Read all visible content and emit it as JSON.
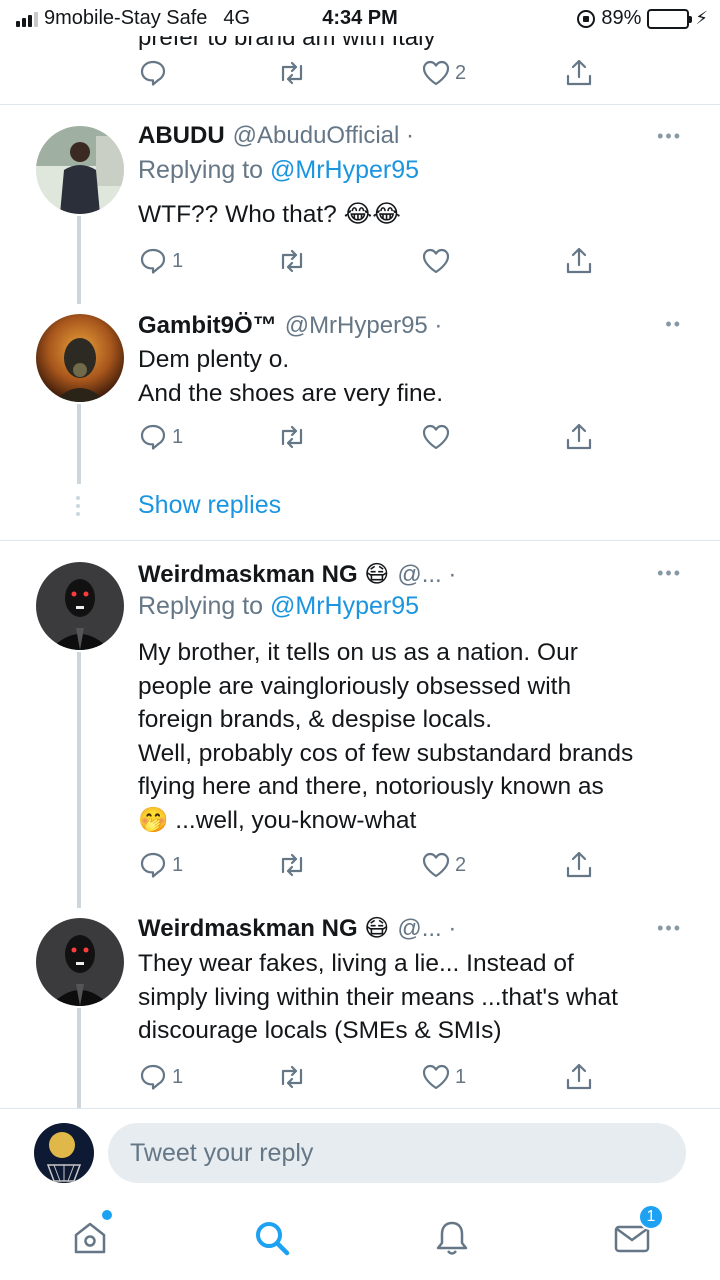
{
  "status_bar": {
    "carrier": "9mobile-Stay Safe",
    "network": "4G",
    "time": "4:34 PM",
    "battery": "89%",
    "battery_level": 0.89
  },
  "top_cut_text": "prefer to brand am with Italy",
  "top_actions": {
    "reply": "",
    "retweet": "",
    "like": "2"
  },
  "tweets": [
    {
      "name": "ABUDU",
      "handle": "@AbuduOfficial ·",
      "replying_label": "Replying to",
      "replying_handle": "@MrHyper95",
      "text": "WTF?? Who that? 😂😂",
      "reply_count": "1",
      "retweet_count": "",
      "like_count": ""
    },
    {
      "name": "Gambit9Ö™",
      "handle": "@MrHyper95 ·",
      "text": "Dem plenty o.\nAnd the shoes are very fine.",
      "reply_count": "1",
      "retweet_count": "",
      "like_count": ""
    },
    {
      "name": "Weirdmaskman NG 😷",
      "handle": "@... ·",
      "replying_label": "Replying to",
      "replying_handle": "@MrHyper95",
      "text": "My brother, it tells on us as a nation. Our\npeople are vaingloriously obsessed with\nforeign brands, & despise locals.\nWell, probably cos of few substandard brands\nflying here and there, notoriously known as\n🤭 ...well, you-know-what",
      "reply_count": "1",
      "retweet_count": "",
      "like_count": "2"
    },
    {
      "name": "Weirdmaskman NG 😷",
      "handle": "@... ·",
      "text": "They wear fakes, living a lie... Instead of\nsimply living within their means ...that's what\ndiscourage locals (SMEs & SMIs)",
      "reply_count": "1",
      "retweet_count": "",
      "like_count": "1"
    }
  ],
  "show_replies": "Show replies",
  "composer": {
    "placeholder": "Tweet your reply"
  },
  "tabbar": {
    "messages_badge": "1",
    "icons": [
      "home-icon",
      "search-icon",
      "notifications-icon",
      "messages-icon"
    ]
  },
  "colors": {
    "accent": "#1da1f2",
    "link": "#1b95e0",
    "muted": "#657786",
    "line": "#ccd6dd"
  }
}
